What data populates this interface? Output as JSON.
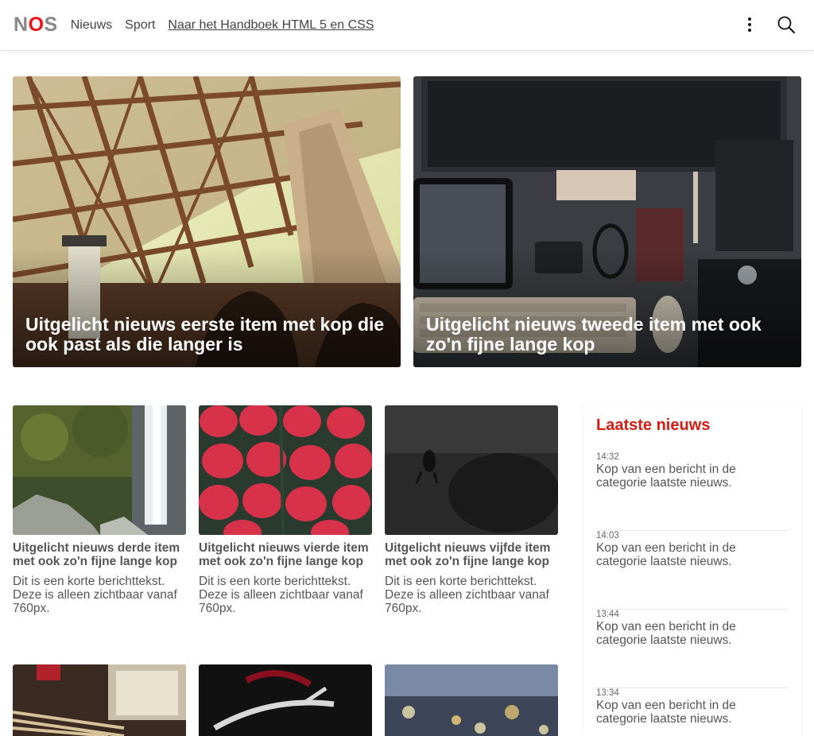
{
  "header": {
    "logo_n": "N",
    "logo_o": "O",
    "logo_s": "S",
    "nav": [
      "Nieuws",
      "Sport"
    ],
    "link": "Naar het Handboek HTML 5 en CSS"
  },
  "featured": [
    {
      "title": "Uitgelicht nieuws eerste item met kop die ook past als die langer is"
    },
    {
      "title": "Uitgelicht nieuws tweede item met ook zo'n fijne lange kop"
    }
  ],
  "cards": [
    {
      "title": "Uitgelicht nieuws derde item met ook zo'n fijne lange kop",
      "text": "Dit is een korte berichttekst. Deze is alleen zichtbaar vanaf 760px."
    },
    {
      "title": "Uitgelicht nieuws vierde item met ook zo'n fijne lange kop",
      "text": "Dit is een korte berichttekst. Deze is alleen zichtbaar vanaf 760px."
    },
    {
      "title": "Uitgelicht nieuws vijfde item met ook zo'n fijne lange kop",
      "text": "Dit is een korte berichttekst. Deze is alleen zichtbaar vanaf 760px."
    }
  ],
  "sidebar": {
    "heading": "Laatste nieuws",
    "items": [
      {
        "time": "14:32",
        "title": "Kop van een bericht in de categorie laatste nieuws."
      },
      {
        "time": "14:03",
        "title": "Kop van een bericht in de categorie laatste nieuws."
      },
      {
        "time": "13:44",
        "title": "Kop van een bericht in de categorie laatste nieuws."
      },
      {
        "time": "13:34",
        "title": "Kop van een bericht in de categorie laatste nieuws."
      }
    ]
  },
  "icons": {
    "menu": "kebab-menu-icon",
    "search": "search-icon"
  },
  "colors": {
    "brand_red": "#d81b10",
    "logo_grey": "#888888",
    "text": "#555555"
  }
}
